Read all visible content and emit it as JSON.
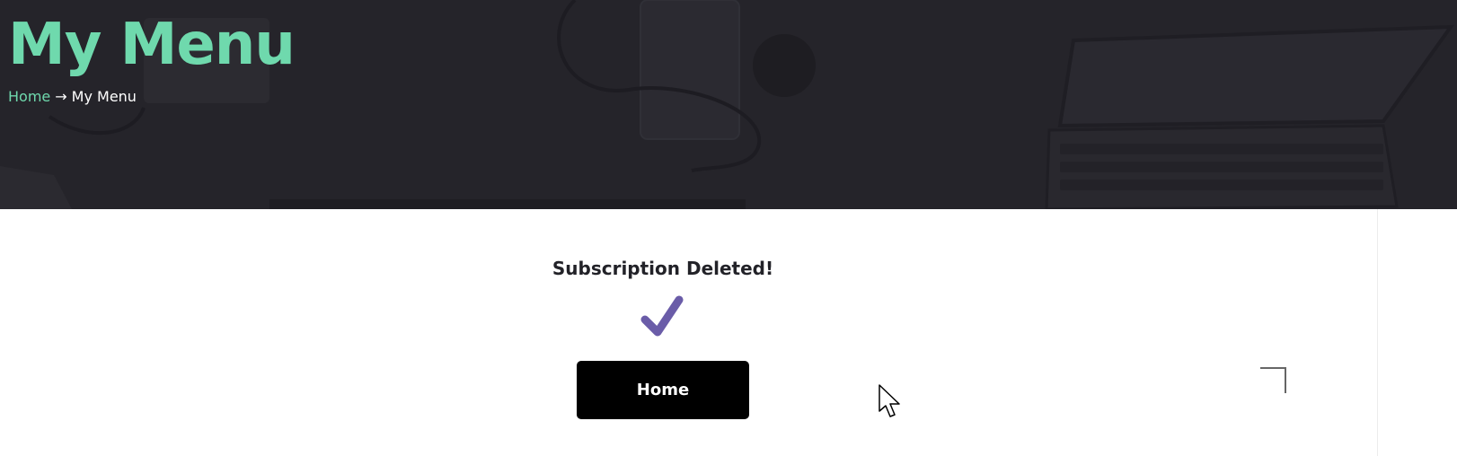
{
  "header": {
    "title": "My Menu",
    "breadcrumb": {
      "home_label": "Home",
      "separator": "→",
      "current_label": "My Menu"
    }
  },
  "main": {
    "status_heading": "Subscription Deleted!",
    "status_icon": "checkmark-icon",
    "home_button_label": "Home"
  },
  "colors": {
    "accent": "#6fd9ad",
    "hero_background": "#25242a",
    "checkmark": "#6a5ca8",
    "button": "#000000"
  }
}
